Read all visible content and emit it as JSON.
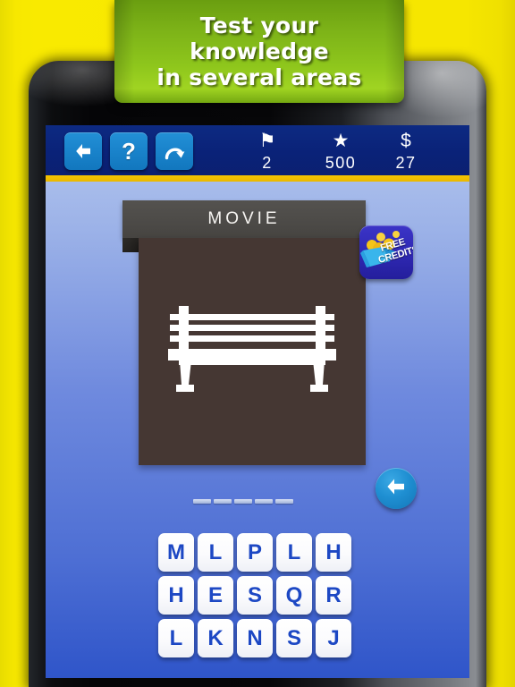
{
  "promo": {
    "text": "Test your\nknowledge\nin several areas",
    "bg_color": "#8ec61c"
  },
  "backdrop": {
    "color": "#f4e500"
  },
  "toolbar": {
    "bg_color": "#0a2278",
    "accent_color": "#f6c400",
    "buttons": [
      {
        "name": "back-button",
        "icon": "left-arrow-icon",
        "label": ""
      },
      {
        "name": "hint-button",
        "icon": "question-mark-icon",
        "label": "?"
      },
      {
        "name": "skip-button",
        "icon": "redo-arrow-icon",
        "label": ""
      }
    ],
    "stats": [
      {
        "icon": "flag-icon",
        "glyph": "⚑",
        "value": "2"
      },
      {
        "icon": "star-icon",
        "glyph": "★",
        "value": "500"
      },
      {
        "icon": "coin-icon",
        "glyph": "$",
        "value": "27"
      }
    ]
  },
  "puzzle": {
    "category": "MOVIE",
    "image_subject": "park-bench",
    "panel_color": "#453733",
    "header_color": "#4c4a47"
  },
  "free_credits": {
    "label": "FREE\nCREDITS",
    "bg_color": "#2f29b4"
  },
  "answer": {
    "slot_count": 5,
    "letters": [
      "",
      "",
      "",
      "",
      ""
    ]
  },
  "backspace": {
    "name": "backspace-button",
    "icon": "left-arrow-icon"
  },
  "keyboard": {
    "rows": [
      [
        "M",
        "L",
        "P",
        "L",
        "H"
      ],
      [
        "H",
        "E",
        "S",
        "Q",
        "R"
      ],
      [
        "L",
        "K",
        "N",
        "S",
        "J"
      ]
    ],
    "key_text_color": "#1d48c4"
  }
}
